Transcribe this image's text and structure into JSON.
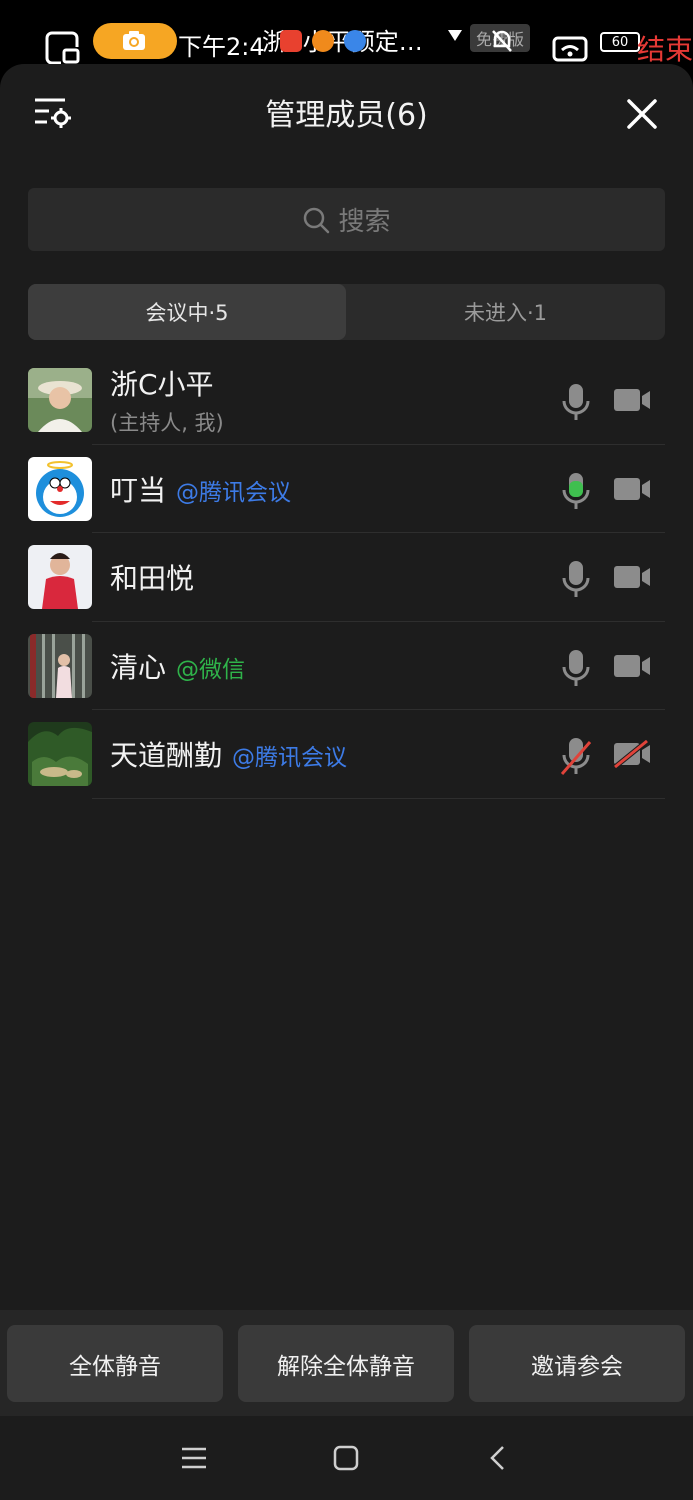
{
  "status_bar": {
    "time": "下午2:4",
    "notification_title": "浙C小平预定…",
    "badge": "免费版",
    "battery": "60",
    "end_label": "结束"
  },
  "header": {
    "title": "管理成员(6)"
  },
  "search": {
    "placeholder": "搜索"
  },
  "tabs": [
    {
      "label": "会议中·5",
      "active": true
    },
    {
      "label": "未进入·1",
      "active": false
    }
  ],
  "members": [
    {
      "name": "浙C小平",
      "subtitle": "(主持人, 我)",
      "tag": "",
      "tag_color": "",
      "mic": "idle",
      "camera": "idle",
      "avatar": "avatar-hat-woman"
    },
    {
      "name": "叮当",
      "subtitle": "",
      "tag": "@腾讯会议",
      "tag_color": "#3d7be6",
      "mic": "speaking",
      "camera": "idle",
      "avatar": "avatar-doraemon"
    },
    {
      "name": "和田悦",
      "subtitle": "",
      "tag": "",
      "tag_color": "",
      "mic": "idle",
      "camera": "idle",
      "avatar": "avatar-red-dress"
    },
    {
      "name": "清心",
      "subtitle": "",
      "tag": "@微信",
      "tag_color": "#2fb34a",
      "mic": "idle",
      "camera": "idle",
      "avatar": "avatar-garden"
    },
    {
      "name": "天道酬勤",
      "subtitle": "",
      "tag": "@腾讯会议",
      "tag_color": "#3d7be6",
      "mic": "muted",
      "camera": "off",
      "avatar": "avatar-plants"
    }
  ],
  "actions": {
    "mute_all": "全体静音",
    "unmute_all": "解除全体静音",
    "invite": "邀请参会"
  },
  "colors": {
    "speaking_green": "#3fbf4f",
    "muted_red": "#e0433a",
    "icon_gray": "#8c8c8c"
  }
}
